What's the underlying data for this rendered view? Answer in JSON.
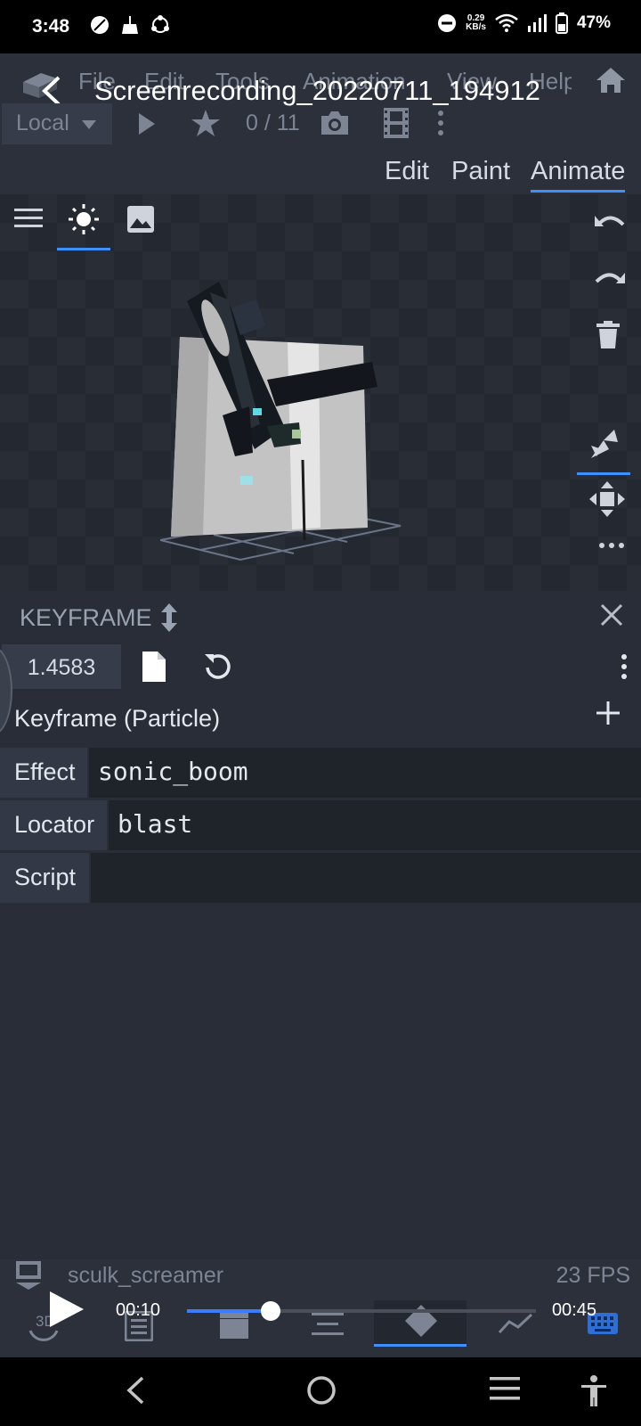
{
  "status_bar": {
    "time": "3:48",
    "net_speed_value": "0.29",
    "net_speed_unit": "KB/s",
    "battery": "47%"
  },
  "menu": {
    "items": [
      "File",
      "Edit",
      "Tools",
      "Animation",
      "View",
      "Help"
    ]
  },
  "recording": {
    "title": "Screenrecording_20220711_194912",
    "project_name": "sculk_screamer",
    "fps": "23 FPS",
    "current_time": "00:10",
    "end_time": "00:45",
    "progress": 0.24
  },
  "toolbar": {
    "space_mode": "Local",
    "counter": "0 / 11"
  },
  "mode_tabs": {
    "edit": "Edit",
    "paint": "Paint",
    "animate": "Animate",
    "active": "Animate"
  },
  "keyframe_panel": {
    "header": "KEYFRAME",
    "time_value": "1.4583",
    "title": "Keyframe (Particle)",
    "fields": [
      {
        "label": "Effect",
        "value": "sonic_boom"
      },
      {
        "label": "Locator",
        "value": "blast"
      },
      {
        "label": "Script",
        "value": ""
      }
    ]
  },
  "bottom_bar": {
    "view_label": "3D"
  },
  "colors": {
    "accent": "#3e90ff",
    "panel_bg": "#282d37",
    "header_bg": "#2b303b"
  }
}
